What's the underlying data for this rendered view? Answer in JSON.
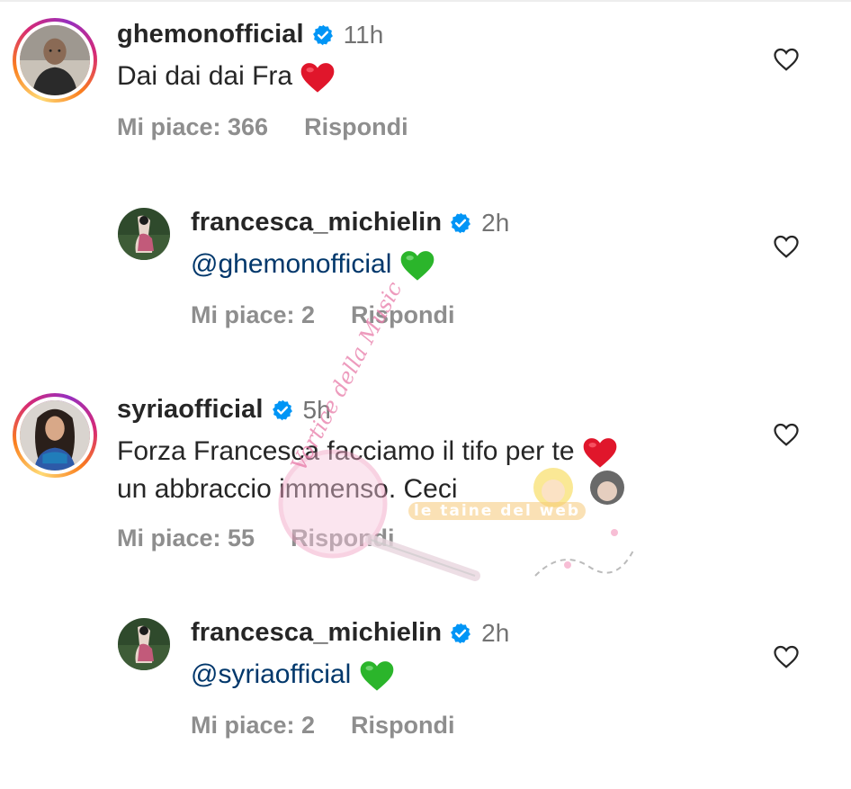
{
  "comments": [
    {
      "username": "ghemonofficial",
      "time": "11h",
      "text": "Dai dai dai Fra",
      "emoji": "red-heart",
      "likes": "Mi piace: 366",
      "reply": "Rispondi"
    },
    {
      "username": "francesca_michielin",
      "time": "2h",
      "mention": "@ghemonofficial",
      "emoji": "green-heart",
      "likes": "Mi piace: 2",
      "reply": "Rispondi"
    },
    {
      "username": "syriaofficial",
      "time": "5h",
      "text_line1": "Forza Francesca facciamo il tifo per te",
      "text_line2": "un abbraccio immenso. Ceci",
      "emoji": "red-heart",
      "likes": "Mi piace: 55",
      "reply": "Rispondi"
    },
    {
      "username": "francesca_michielin",
      "time": "2h",
      "mention": "@syriaofficial",
      "emoji": "green-heart",
      "likes": "Mi piace: 2",
      "reply": "Rispondi"
    }
  ],
  "watermark": {
    "left_text": "Vortice della Music",
    "right_text": "le taine del web"
  },
  "colors": {
    "text": "#262626",
    "meta": "#8e8e8e",
    "time": "#737373",
    "mention": "#00376b",
    "verified": "#0095f6",
    "red_heart": "#e0162b",
    "green_heart": "#2bb52b"
  }
}
